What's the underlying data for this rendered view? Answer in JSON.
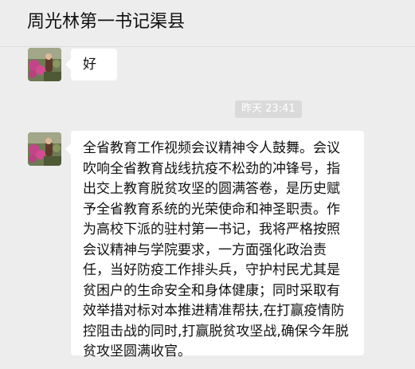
{
  "header": {
    "title": "周光林第一书记渠县"
  },
  "messages": [
    {
      "sender": "avatar",
      "text": "好"
    },
    {
      "sender": "avatar",
      "text": "全省教育工作视频会议精神令人鼓舞。会议吹响全省教育战线抗疫不松劲的冲锋号，指出交上教育脱贫攻坚的圆满答卷，是历史赋予全省教育系统的光荣使命和神圣职责。作为高校下派的驻村第一书记，我将严格按照会议精神与学院要求，一方面强化政治责任，当好防疫工作排头兵，守护村民尤其是贫困户的生命安全和身体健康；同时采取有效举措对标对本推进精准帮扶,在打赢疫情防控阻击战的同时,打赢脱贫攻坚战,确保今年脱贫攻坚圆满收官。"
    }
  ],
  "timestamp": "昨天 23:41",
  "colors": {
    "background": "#ededed",
    "bubble": "#ffffff",
    "timestamp_bg": "#dadada"
  }
}
